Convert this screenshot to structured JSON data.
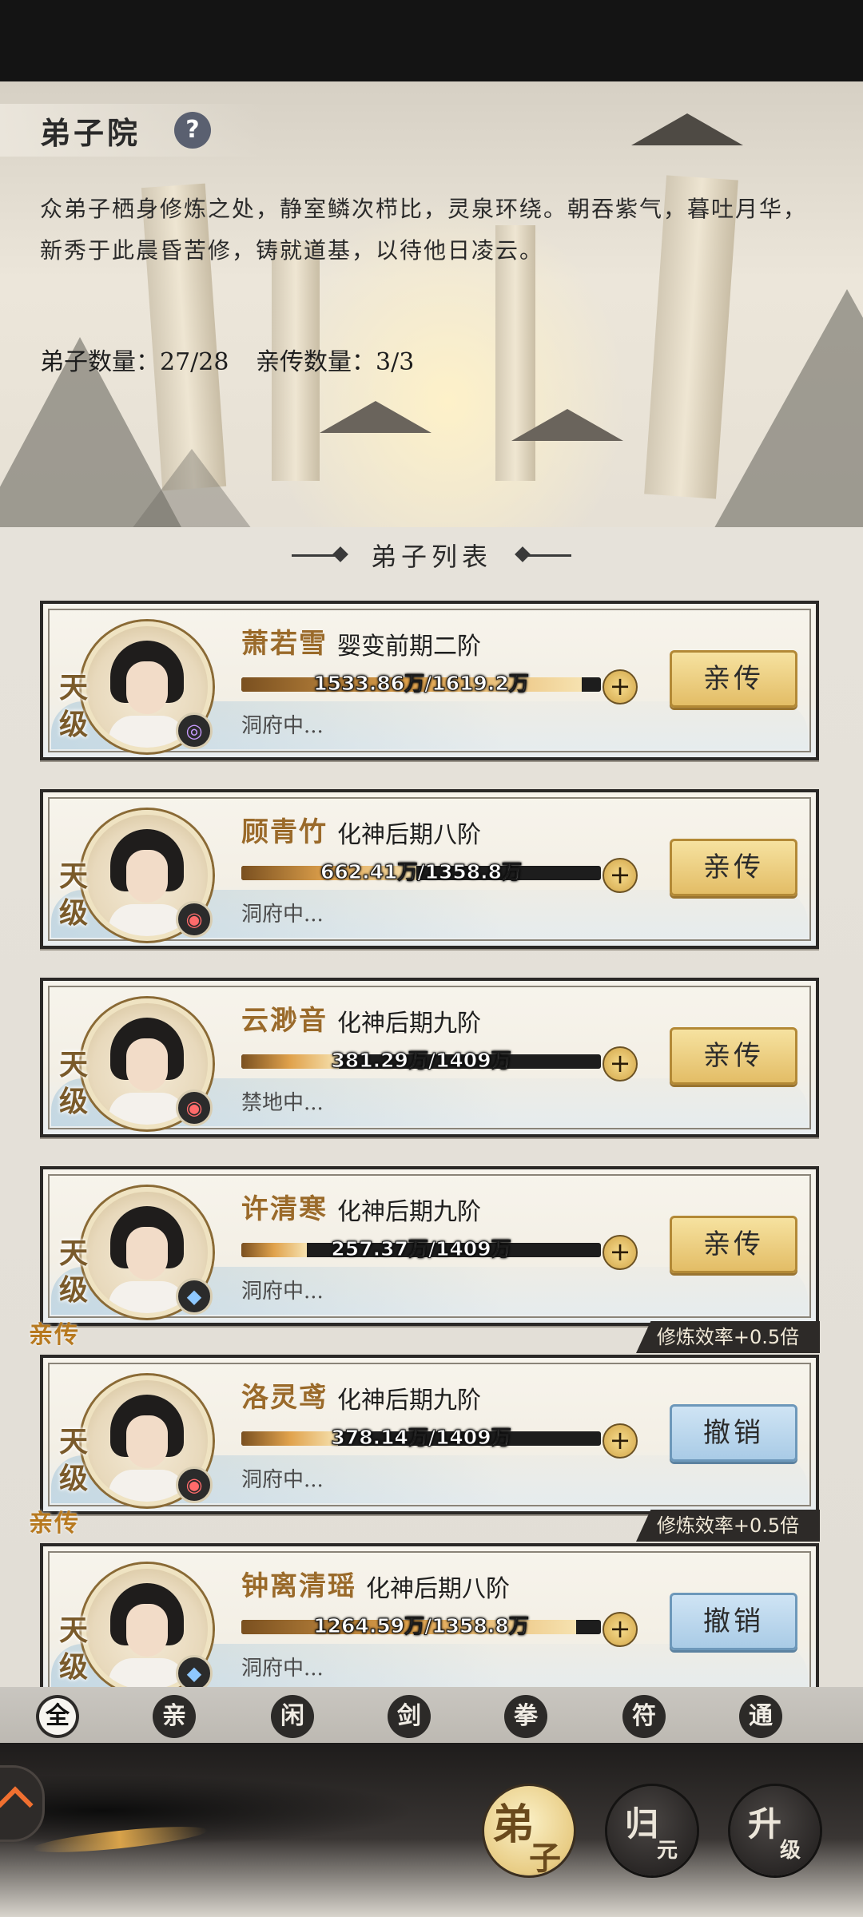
{
  "header": {
    "title": "弟子院",
    "help_icon": "?",
    "description": "众弟子栖身修炼之处，静室鳞次栉比，灵泉环绕。朝吞紫气，暮吐月华，新秀于此晨昏苦修，铸就道基，以待他日凌云。",
    "disciple_count": "弟子数量：27/28",
    "direct_count": "亲传数量：3/3"
  },
  "section_title": "弟子列表",
  "disciples": [
    {
      "name": "萧若雪",
      "realm": "婴变前期二阶",
      "grade": "天级",
      "progress_text": "1533.86万/1619.2万",
      "progress": 0.947,
      "location": "洞府中...",
      "element": "purple",
      "element_glyph": "◎",
      "action": "亲传",
      "action_style": "gold",
      "is_direct": false
    },
    {
      "name": "顾青竹",
      "realm": "化神后期八阶",
      "grade": "天级",
      "progress_text": "662.41万/1358.8万",
      "progress": 0.487,
      "location": "洞府中...",
      "element": "red",
      "element_glyph": "◉",
      "action": "亲传",
      "action_style": "gold",
      "is_direct": false
    },
    {
      "name": "云渺音",
      "realm": "化神后期九阶",
      "grade": "天级",
      "progress_text": "381.29万/1409万",
      "progress": 0.271,
      "location": "禁地中...",
      "element": "red",
      "element_glyph": "◉",
      "action": "亲传",
      "action_style": "gold",
      "is_direct": false
    },
    {
      "name": "许清寒",
      "realm": "化神后期九阶",
      "grade": "天级",
      "progress_text": "257.37万/1409万",
      "progress": 0.183,
      "location": "洞府中...",
      "element": "blue",
      "element_glyph": "◆",
      "action": "亲传",
      "action_style": "gold",
      "is_direct": false
    },
    {
      "name": "洛灵鸢",
      "realm": "化神后期九阶",
      "grade": "天级",
      "progress_text": "378.14万/1409万",
      "progress": 0.268,
      "location": "洞府中...",
      "element": "red",
      "element_glyph": "◉",
      "action": "撤销",
      "action_style": "blue",
      "is_direct": true,
      "direct_tag": "亲传",
      "effect_tag": "修炼效率+0.5倍"
    },
    {
      "name": "钟离清瑶",
      "realm": "化神后期八阶",
      "grade": "天级",
      "progress_text": "1264.59万/1358.8万",
      "progress": 0.931,
      "location": "洞府中...",
      "element": "blue",
      "element_glyph": "◆",
      "action": "撤销",
      "action_style": "blue",
      "is_direct": true,
      "direct_tag": "亲传",
      "effect_tag": "修炼效率+0.5倍"
    }
  ],
  "filters": [
    {
      "label": "全",
      "active": true
    },
    {
      "label": "亲",
      "active": false
    },
    {
      "label": "闲",
      "active": false
    },
    {
      "label": "剑",
      "active": false
    },
    {
      "label": "拳",
      "active": false
    },
    {
      "label": "符",
      "active": false
    },
    {
      "label": "通",
      "active": false
    }
  ],
  "bottom_nav": [
    {
      "c1": "弟",
      "c2": "子",
      "active": true
    },
    {
      "c1": "归",
      "c2": "元",
      "active": false
    },
    {
      "c1": "升",
      "c2": "级",
      "active": false
    }
  ]
}
